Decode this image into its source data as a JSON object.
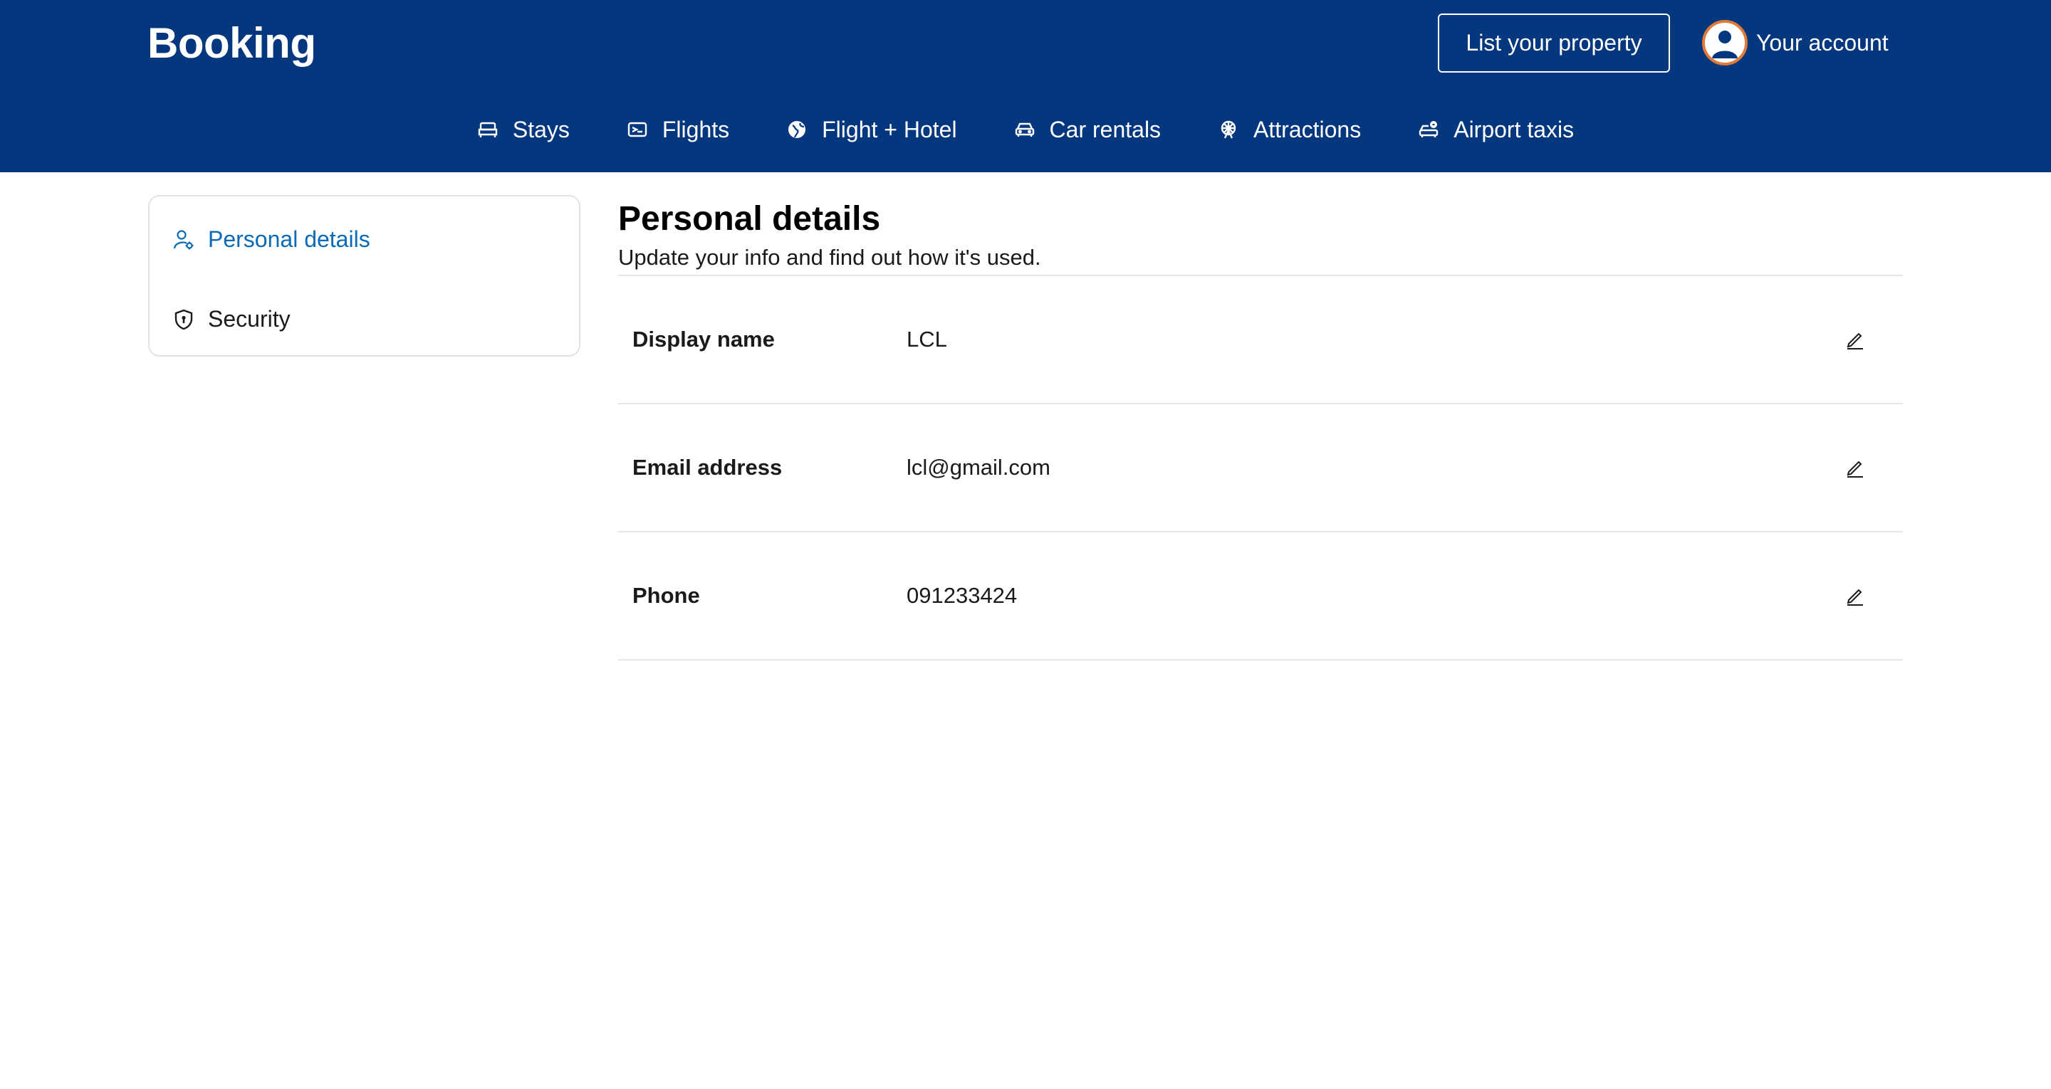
{
  "header": {
    "logo": "Booking",
    "list_property_label": "List your property",
    "account_label": "Your account"
  },
  "nav": {
    "items": [
      {
        "label": "Stays",
        "icon": "bed-icon"
      },
      {
        "label": "Flights",
        "icon": "plane-icon"
      },
      {
        "label": "Flight + Hotel",
        "icon": "globe-icon"
      },
      {
        "label": "Car rentals",
        "icon": "car-icon"
      },
      {
        "label": "Attractions",
        "icon": "ferris-wheel-icon"
      },
      {
        "label": "Airport taxis",
        "icon": "taxi-icon"
      }
    ]
  },
  "sidebar": {
    "items": [
      {
        "label": "Personal details",
        "icon": "user-settings-icon",
        "active": true
      },
      {
        "label": "Security",
        "icon": "shield-icon",
        "active": false
      }
    ]
  },
  "main": {
    "title": "Personal details",
    "subtitle": "Update your info and find out how it's used.",
    "rows": [
      {
        "label": "Display name",
        "value": "LCL"
      },
      {
        "label": "Email address",
        "value": "lcl@gmail.com"
      },
      {
        "label": "Phone",
        "value": "091233424"
      }
    ]
  },
  "colors": {
    "brand_header": "#04377e",
    "active_link": "#0a6ab6",
    "avatar_ring": "#e07a39"
  }
}
